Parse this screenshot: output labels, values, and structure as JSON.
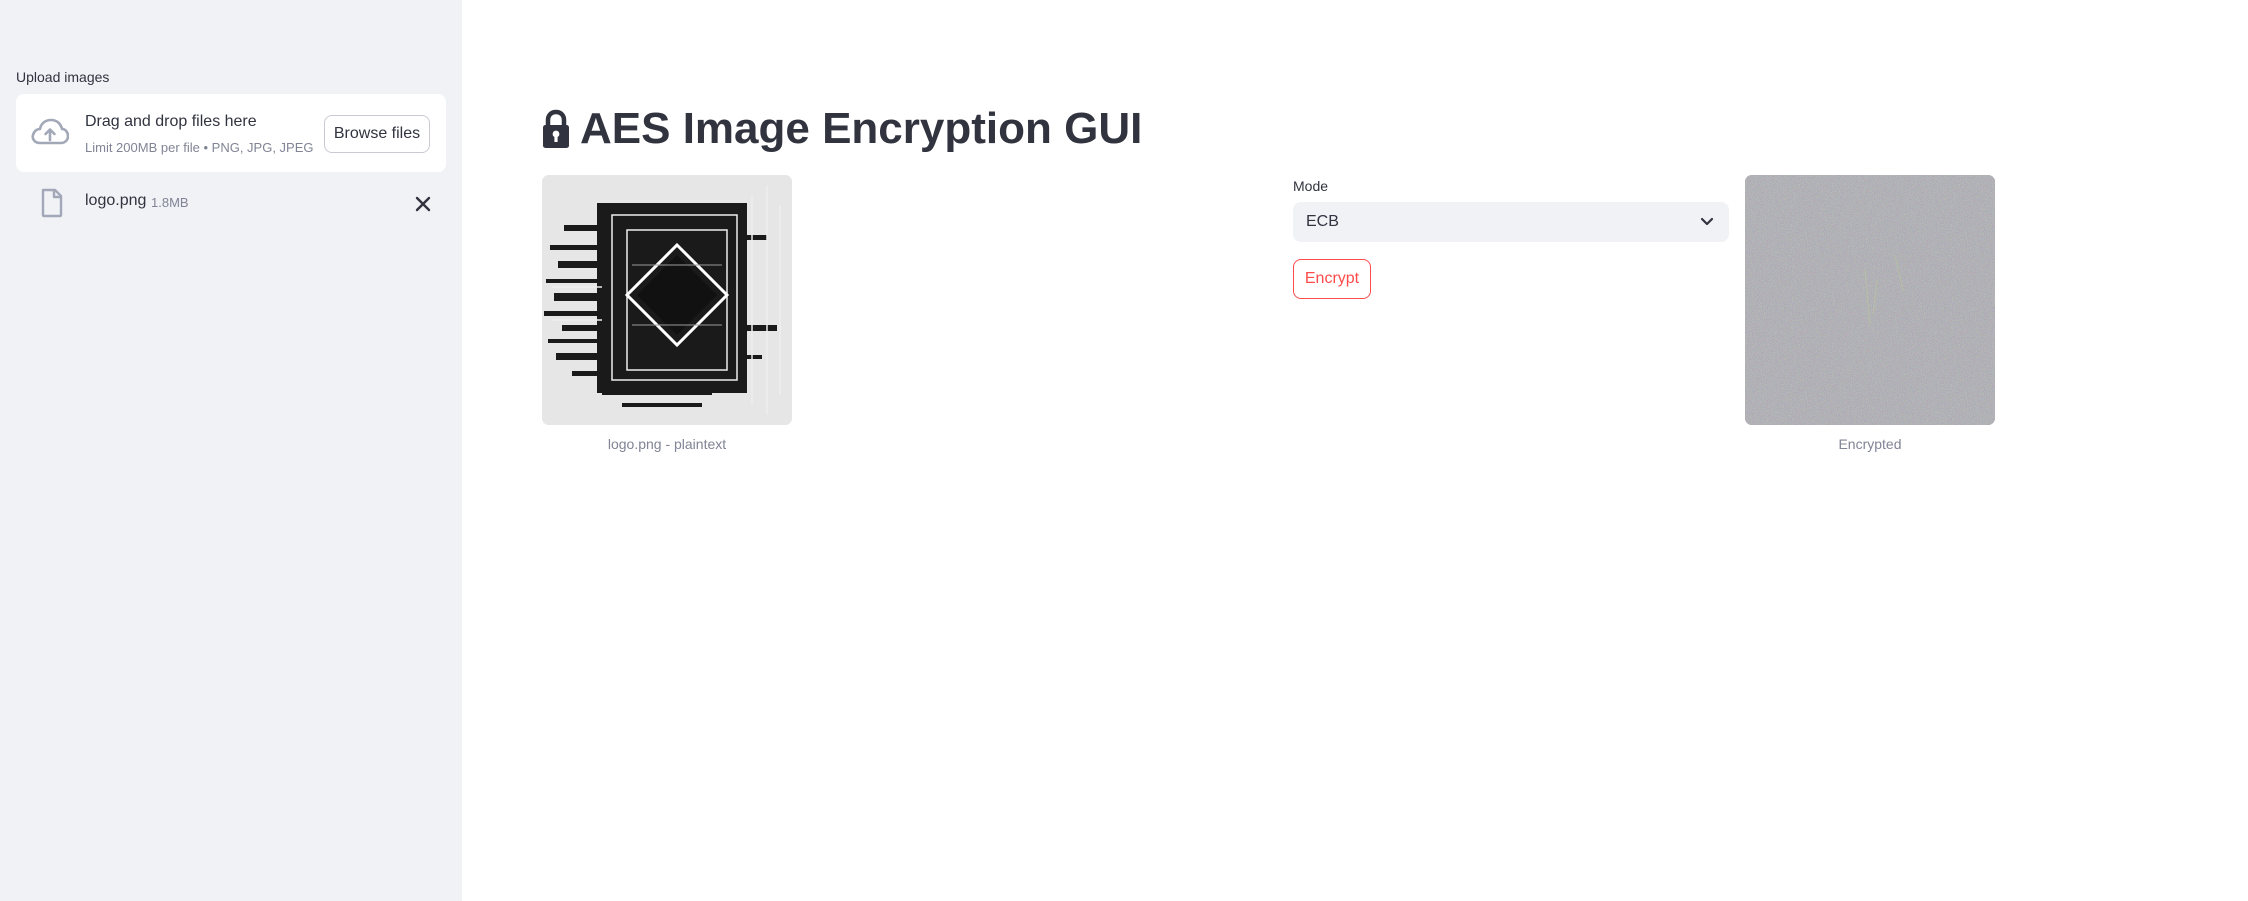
{
  "sidebar": {
    "upload_label": "Upload images",
    "dropzone": {
      "title": "Drag and drop files here",
      "subtitle": "Limit 200MB per file • PNG, JPG, JPEG",
      "browse_label": "Browse files",
      "icon": "cloud-upload-icon"
    },
    "file": {
      "name": "logo.png",
      "size": "1.8MB",
      "icon": "file-icon",
      "remove_icon": "close-icon"
    }
  },
  "main": {
    "title": "AES Image Encryption GUI",
    "title_icon": "lock-icon",
    "plain_caption": "logo.png - plaintext",
    "encrypted_caption": "Encrypted",
    "mode": {
      "label": "Mode",
      "value": "ECB"
    },
    "encrypt_label": "Encrypt"
  },
  "colors": {
    "sidebar_bg": "#f0f2f6",
    "accent": "#ff4b4b",
    "text": "#31333f",
    "muted": "#808495"
  }
}
